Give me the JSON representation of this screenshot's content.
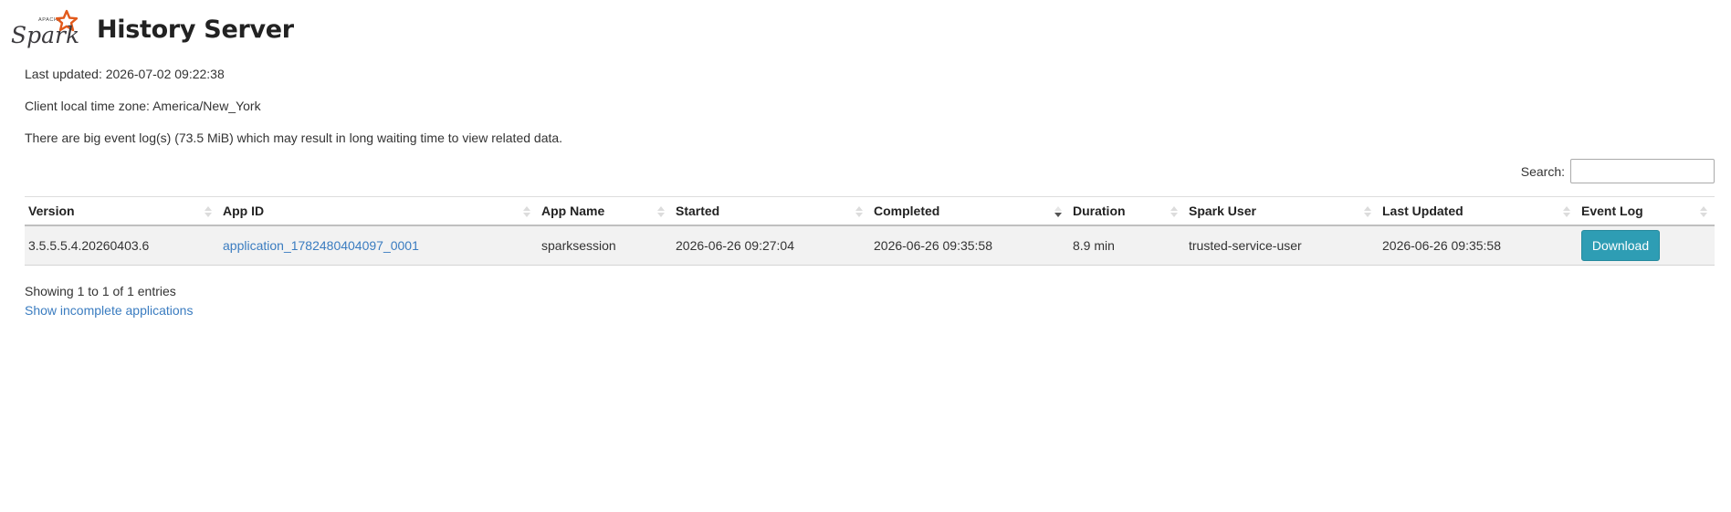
{
  "header": {
    "logo_name": "spark-logo",
    "logo_small_text": "APACHE",
    "logo_text": "Spark",
    "title": "History Server"
  },
  "info": {
    "last_updated": "Last updated: 2026-07-02 09:22:38",
    "timezone": "Client local time zone: America/New_York",
    "warning": "There are big event log(s) (73.5 MiB) which may result in long waiting time to view related data."
  },
  "search": {
    "label": "Search:",
    "value": "",
    "placeholder": ""
  },
  "table": {
    "columns": [
      {
        "label": "Version",
        "sort": "none"
      },
      {
        "label": "App ID",
        "sort": "none"
      },
      {
        "label": "App Name",
        "sort": "none"
      },
      {
        "label": "Started",
        "sort": "none"
      },
      {
        "label": "Completed",
        "sort": "desc"
      },
      {
        "label": "Duration",
        "sort": "none"
      },
      {
        "label": "Spark User",
        "sort": "none"
      },
      {
        "label": "Last Updated",
        "sort": "none"
      },
      {
        "label": "Event Log",
        "sort": "none"
      }
    ],
    "rows": [
      {
        "version": "3.5.5.5.4.20260403.6",
        "app_id": "application_1782480404097_0001",
        "app_name": "sparksession",
        "started": "2026-06-26 09:27:04",
        "completed": "2026-06-26 09:35:58",
        "duration": "8.9 min",
        "spark_user": "trusted-service-user",
        "last_updated": "2026-06-26 09:35:58",
        "event_log_button": "Download"
      }
    ]
  },
  "footer": {
    "showing": "Showing 1 to 1 of 1 entries",
    "show_incomplete": "Show incomplete applications"
  },
  "colors": {
    "link": "#3a7cc0",
    "button": "#2e9db4",
    "logo_orange": "#e25a1c",
    "row_bg": "#f2f2f2"
  }
}
